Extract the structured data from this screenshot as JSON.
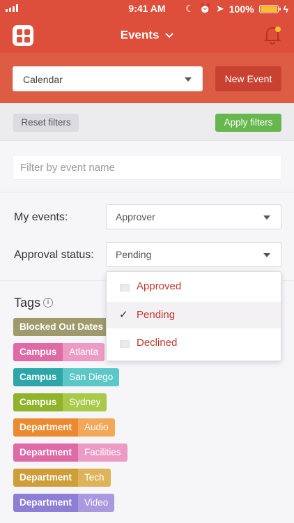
{
  "status_bar": {
    "time": "9:41 AM",
    "battery": "100%"
  },
  "nav": {
    "title": "Events",
    "menu_icon": "apps-grid-icon",
    "bell_icon": "bell-icon"
  },
  "toolbar": {
    "calendar_select": "Calendar",
    "new_event": "New Event"
  },
  "filters": {
    "reset": "Reset filters",
    "apply": "Apply filters",
    "name_placeholder": "Filter by event name",
    "my_events_label": "My events:",
    "my_events_value": "Approver",
    "approval_label": "Approval status:",
    "approval_value": "Pending"
  },
  "approval_options": [
    {
      "label": "Approved",
      "checked": false
    },
    {
      "label": "Pending",
      "checked": true
    },
    {
      "label": "Declined",
      "checked": false
    }
  ],
  "tags_title": "Tags",
  "tags": [
    {
      "key": "Blocked Out Dates",
      "value": "",
      "color": "#9f9a6c",
      "light": "#9f9a6c"
    },
    {
      "key": "Campus",
      "value": "Atlanta",
      "color": "#e06aa5",
      "light": "#ec9cc4"
    },
    {
      "key": "Campus",
      "value": "San Diego",
      "color": "#2ca6a8",
      "light": "#5cc7c7"
    },
    {
      "key": "Campus",
      "value": "Sydney",
      "color": "#8fb329",
      "light": "#a9c94a"
    },
    {
      "key": "Department",
      "value": "Audio",
      "color": "#ec8a30",
      "light": "#f3a758"
    },
    {
      "key": "Department",
      "value": "Facilities",
      "color": "#e06aa5",
      "light": "#ec9cc4"
    },
    {
      "key": "Department",
      "value": "Tech",
      "color": "#cf9e38",
      "light": "#deb45a"
    },
    {
      "key": "Department",
      "value": "Video",
      "color": "#8f7ed6",
      "light": "#a99ae0"
    }
  ],
  "colors": {
    "accent": "#dd4f3a",
    "apply": "#67b74f",
    "option_text": "#c0392b"
  }
}
